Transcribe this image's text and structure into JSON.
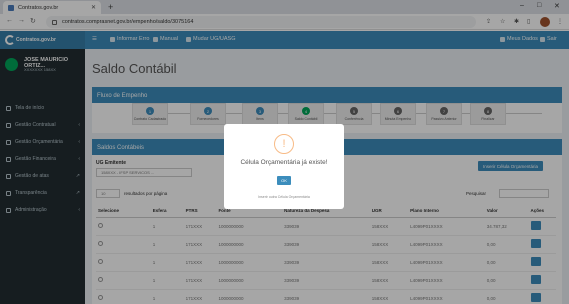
{
  "browser": {
    "tab_title": "Contratos.gov.br",
    "url": "contratos.comprasnet.gov.br/empenho/saldo/3075164"
  },
  "topnav": {
    "brand": "Contratos.gov.br",
    "items": [
      "Informar Erro",
      "Manual",
      "Mudar UG/UASG"
    ],
    "right_items": [
      "Meus Dados",
      "Sair"
    ]
  },
  "user": {
    "name": "JOSE MAURICIO ORTIZ...",
    "ug": "XXXXXXX 158XX"
  },
  "sidebar": {
    "items": [
      {
        "label": "Tela de início"
      },
      {
        "label": "Gestão Contratual"
      },
      {
        "label": "Gestão Orçamentária"
      },
      {
        "label": "Gestão Financeira"
      },
      {
        "label": "Gestão de atas"
      },
      {
        "label": "Transparência"
      },
      {
        "label": "Administração"
      }
    ]
  },
  "page": {
    "title": "Saldo Contábil"
  },
  "flow": {
    "title": "Fluxo de Empenho",
    "steps": [
      {
        "num": "1",
        "label": "Contrato Cadastrado",
        "status": "blue"
      },
      {
        "num": "2",
        "label": "Fornecedores",
        "status": "blue"
      },
      {
        "num": "3",
        "label": "Itens",
        "status": "blue"
      },
      {
        "num": "4",
        "label": "Saldo Contábil",
        "status": "green"
      },
      {
        "num": "5",
        "label": "Conferência",
        "status": "dark"
      },
      {
        "num": "6",
        "label": "Minuta Empenho",
        "status": "dark"
      },
      {
        "num": "7",
        "label": "Passivo Anterior",
        "status": "dark"
      },
      {
        "num": "8",
        "label": "Finalizar",
        "status": "dark"
      }
    ]
  },
  "saldos": {
    "title": "Saldos Contábeis",
    "ug_label": "UG Emitente",
    "ug_value": "158XXX - IFSP SERVICOS ...",
    "insert_button": "Inserir Célula Orçamentária",
    "per_page_value": "10",
    "per_page_suffix": "resultados por página",
    "search_label": "Pesquisar",
    "columns": [
      "Selecione",
      "Esfera",
      "PTRS",
      "Fonte",
      "Natureza da Despesa",
      "UGR",
      "Plano Interno",
      "Valor",
      "Ações"
    ],
    "rows": [
      {
        "esfera": "1",
        "ptrs": "171XXX",
        "fonte": "1000000000",
        "natureza": "339039",
        "ugr": "158XXX",
        "plano": "L4099P01XXXX",
        "valor": "34.787,32"
      },
      {
        "esfera": "1",
        "ptrs": "171XXX",
        "fonte": "1000000000",
        "natureza": "339039",
        "ugr": "158XXX",
        "plano": "L4099P01XXXX",
        "valor": "0,00"
      },
      {
        "esfera": "1",
        "ptrs": "171XXX",
        "fonte": "1000000000",
        "natureza": "339039",
        "ugr": "158XXX",
        "plano": "L4099P01XXXX",
        "valor": "0,00"
      },
      {
        "esfera": "1",
        "ptrs": "171XXX",
        "fonte": "1000000000",
        "natureza": "339039",
        "ugr": "158XXX",
        "plano": "L4099P01XXXX",
        "valor": "0,00"
      },
      {
        "esfera": "1",
        "ptrs": "171XXX",
        "fonte": "1000000000",
        "natureza": "339039",
        "ugr": "158XXX",
        "plano": "L4099P01XXXX",
        "valor": "0,00"
      }
    ]
  },
  "modal": {
    "icon": "!",
    "title": "Célula Orçamentária já existe!",
    "ok_label": "OK",
    "footer": "Inserir outra Célula Orçamentária"
  },
  "colors": {
    "primary": "#3c8dbc",
    "sidebar": "#222d32",
    "success": "#00a65a",
    "warning": "#f8bb86"
  }
}
